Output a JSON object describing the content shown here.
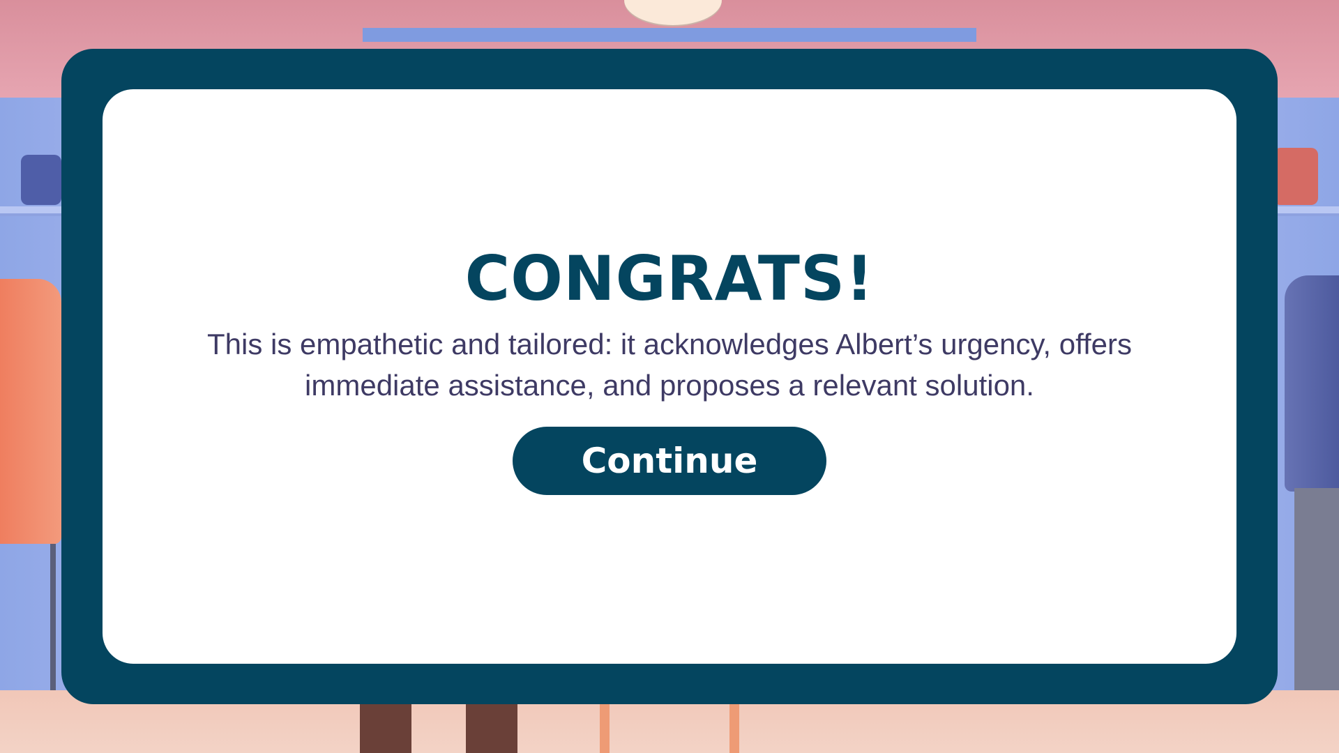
{
  "dialog": {
    "title": "CONGRATS!",
    "message": "This is empathetic and tailored: it acknowledges Albert’s urgency, offers immediate assistance, and proposes a relevant solution.",
    "continue_label": "Continue"
  },
  "colors": {
    "frame": "#04455f",
    "panel": "#ffffff",
    "title_text": "#04455f",
    "message_text": "#3e3a64",
    "button_background": "#04455f",
    "button_text": "#ffffff"
  }
}
